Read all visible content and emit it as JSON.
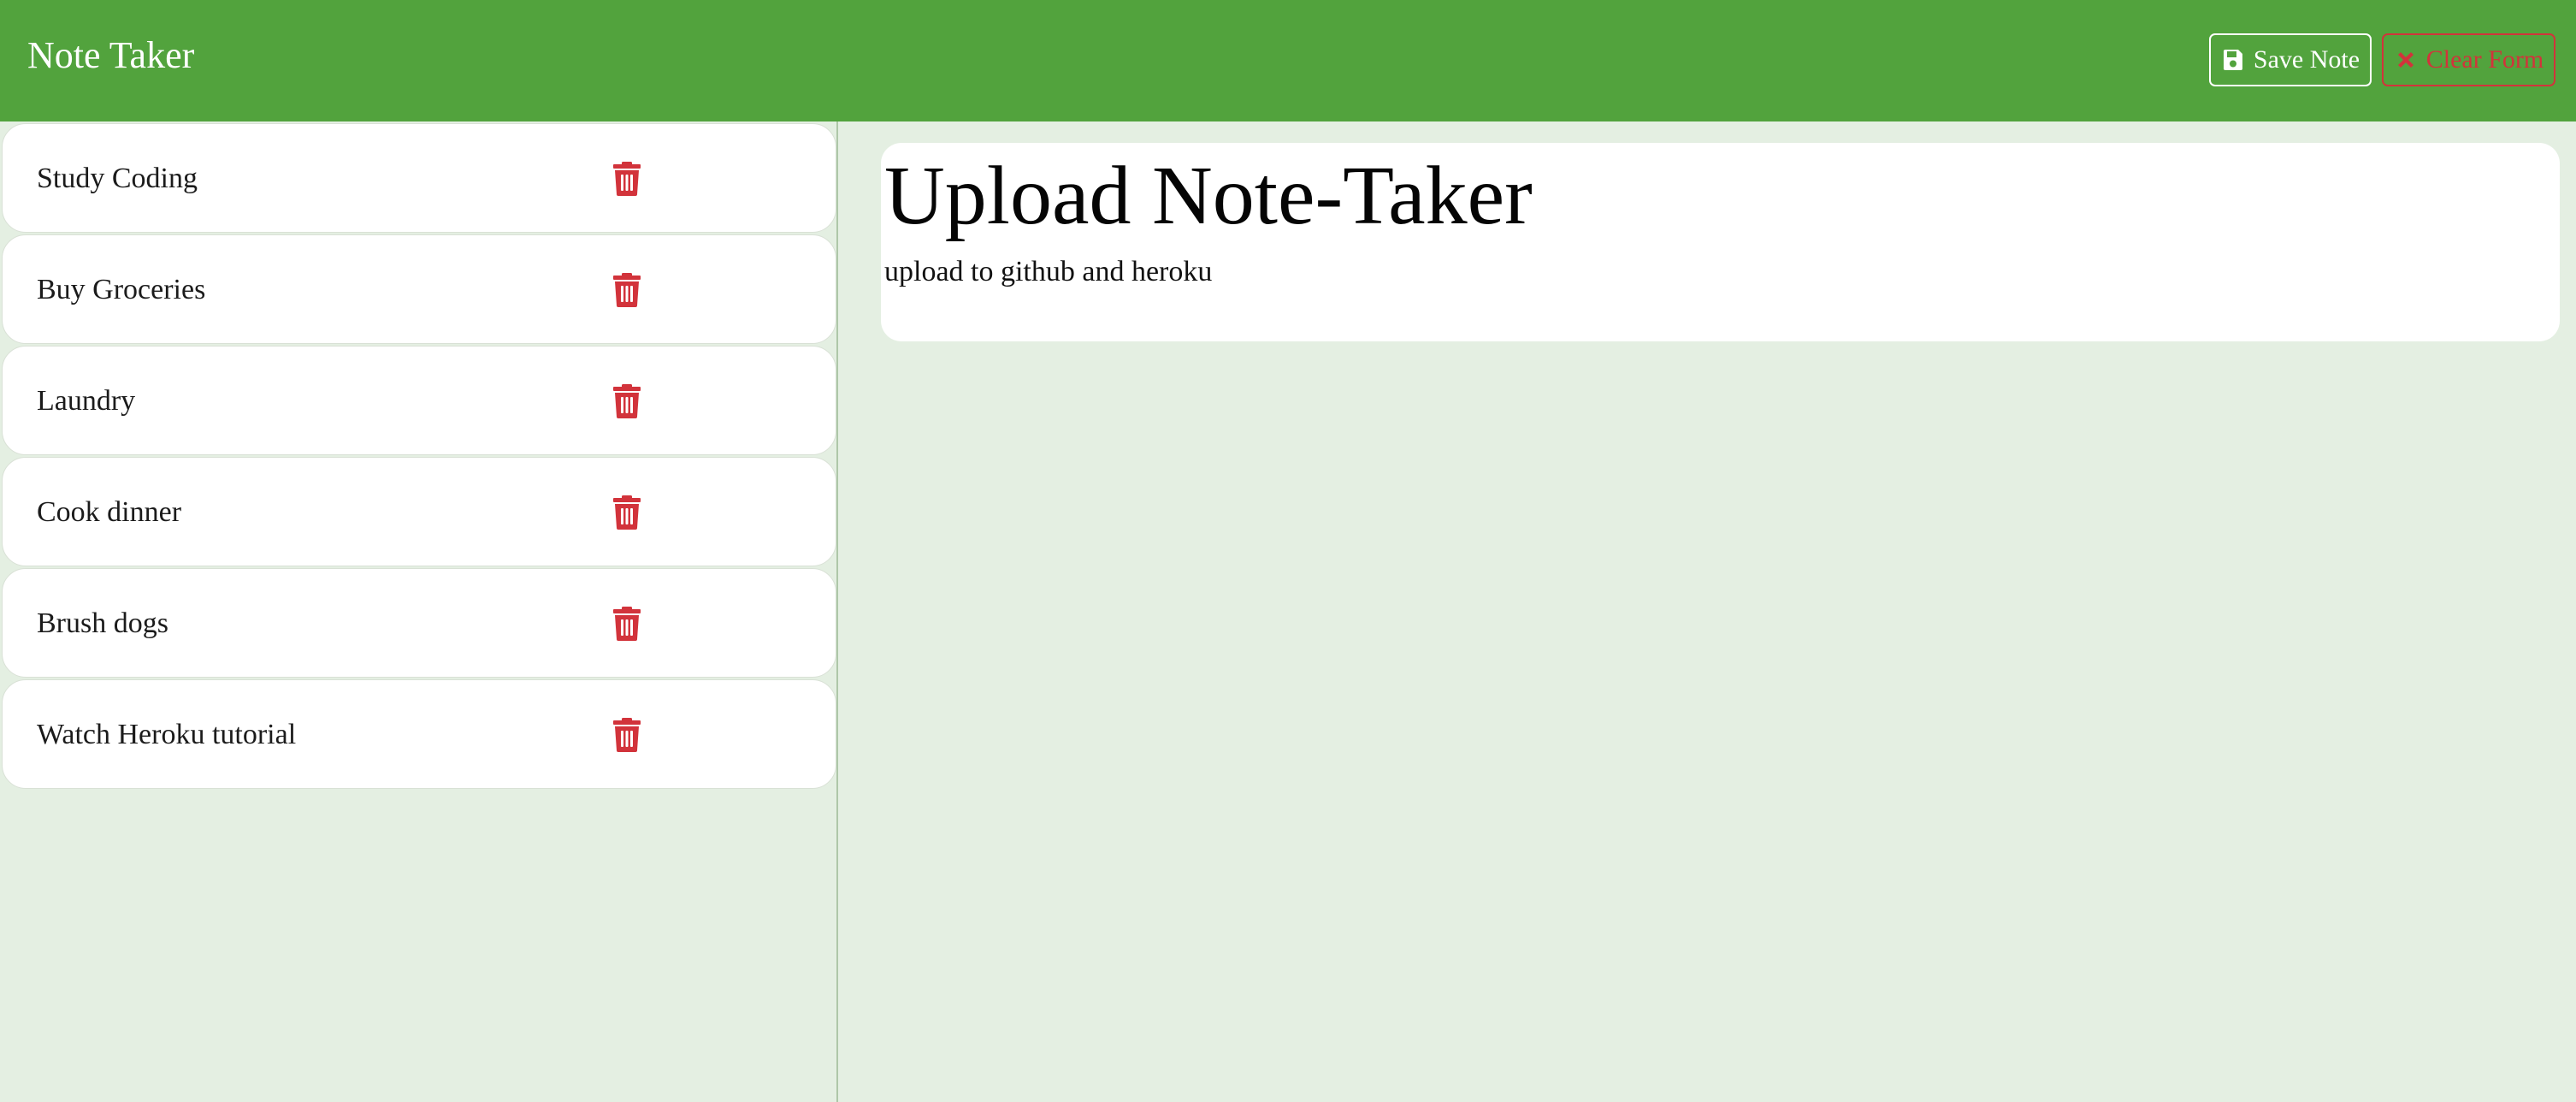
{
  "app": {
    "title": "Note Taker"
  },
  "toolbar": {
    "save_label": "Save Note",
    "save_icon": "save-icon",
    "clear_label": "Clear Form",
    "clear_icon": "close-icon"
  },
  "sidebar": {
    "notes": [
      {
        "title": "Study Coding",
        "icon": "trash-icon"
      },
      {
        "title": "Buy Groceries",
        "icon": "trash-icon"
      },
      {
        "title": "Laundry",
        "icon": "trash-icon"
      },
      {
        "title": "Cook dinner",
        "icon": "trash-icon"
      },
      {
        "title": "Brush dogs",
        "icon": "trash-icon"
      },
      {
        "title": "Watch Heroku tutorial",
        "icon": "trash-icon"
      }
    ]
  },
  "editor": {
    "title_value": "Upload Note-Taker",
    "text_value": "upload to github and heroku "
  },
  "colors": {
    "navbar": "#52a33d",
    "background": "#e4efe2",
    "danger": "#d2333b",
    "card": "#ffffff"
  }
}
